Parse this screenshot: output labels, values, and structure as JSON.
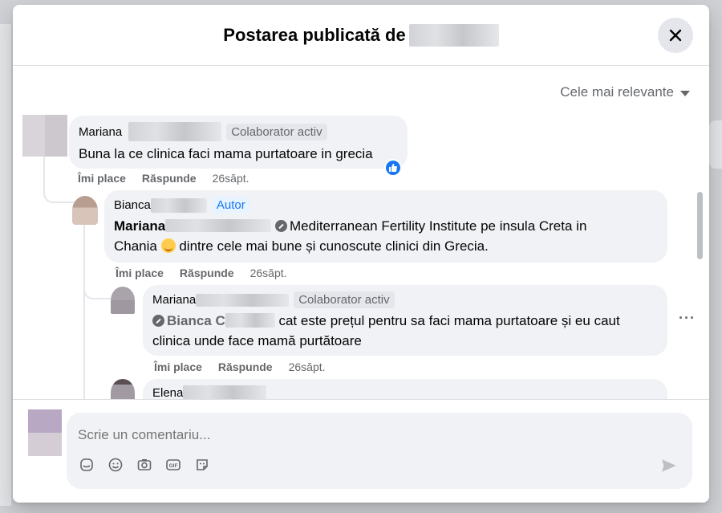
{
  "dialog": {
    "title": "Postarea publicată de",
    "close_icon": "close-icon"
  },
  "sort": {
    "label": "Cele mai relevante"
  },
  "comments": [
    {
      "name": "Mariana",
      "badge": "Colaborator activ",
      "text": "Buna la ce clinica faci mama purtatoare in grecia",
      "actions": {
        "like": "Îmi place",
        "reply": "Răspunde",
        "time": "26săpt."
      },
      "reaction": "like"
    },
    {
      "name": "Bianca",
      "badge": "Autor",
      "mention": "Mariana",
      "page_link": "Mediterranean Fertility Institute",
      "text_after_link": " pe insula Creta in",
      "text_line2_a": "Chania ",
      "text_line2_b": " dintre cele mai bune și cunoscute clinici din Grecia.",
      "actions": {
        "like": "Îmi place",
        "reply": "Răspunde",
        "time": "26săpt."
      }
    },
    {
      "name": "Mariana",
      "badge": "Colaborator activ",
      "mention": "Bianca C",
      "text_after_mention": " cat este prețul pentru sa faci mama purtatoare și eu caut",
      "text_line2": "clinica unde face mamă purtătoare",
      "actions": {
        "like": "Îmi place",
        "reply": "Răspunde",
        "time": "26săpt."
      },
      "more": "···"
    },
    {
      "name": "Elena"
    }
  ],
  "composer": {
    "placeholder": "Scrie un comentariu...",
    "icons": [
      "sticker-icon",
      "emoji-icon",
      "camera-icon",
      "gif-icon",
      "avatar-sticker-icon"
    ],
    "send_icon": "send-icon"
  },
  "colors": {
    "accent": "#1877f2",
    "bubble_bg": "#f0f2f5",
    "secondary_text": "#65676b"
  }
}
